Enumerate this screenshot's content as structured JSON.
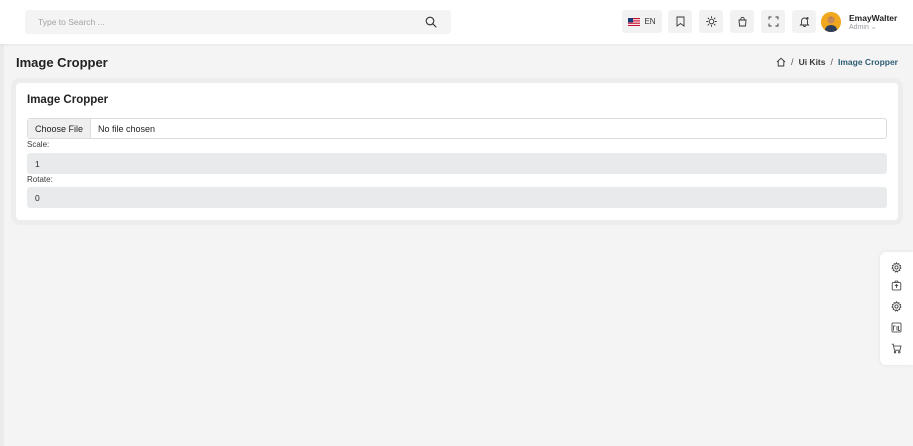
{
  "search": {
    "placeholder": "Type to Search ..."
  },
  "header": {
    "language": "EN",
    "user_name": "EmayWalter",
    "user_role": "Admin ⌄"
  },
  "page": {
    "title": "Image Cropper",
    "breadcrumb": {
      "ui_kits": "Ui Kits",
      "current": "Image Cropper",
      "separator": "/"
    }
  },
  "card": {
    "title": "Image Cropper",
    "file_button": "Choose File",
    "file_status": "No file chosen",
    "scale_label": "Scale:",
    "scale_value": "1",
    "rotate_label": "Rotate:",
    "rotate_value": "0"
  },
  "icons": {
    "toolbar": [
      "bookmark-icon",
      "sun-icon",
      "bag-icon",
      "fullscreen-icon",
      "bell-icon"
    ],
    "dock": [
      "settings-icon",
      "box-icon",
      "settings-icon",
      "image-icon",
      "cart-icon"
    ]
  },
  "colors": {
    "accent": "#2f5d73",
    "avatar": "#f1a81f"
  }
}
